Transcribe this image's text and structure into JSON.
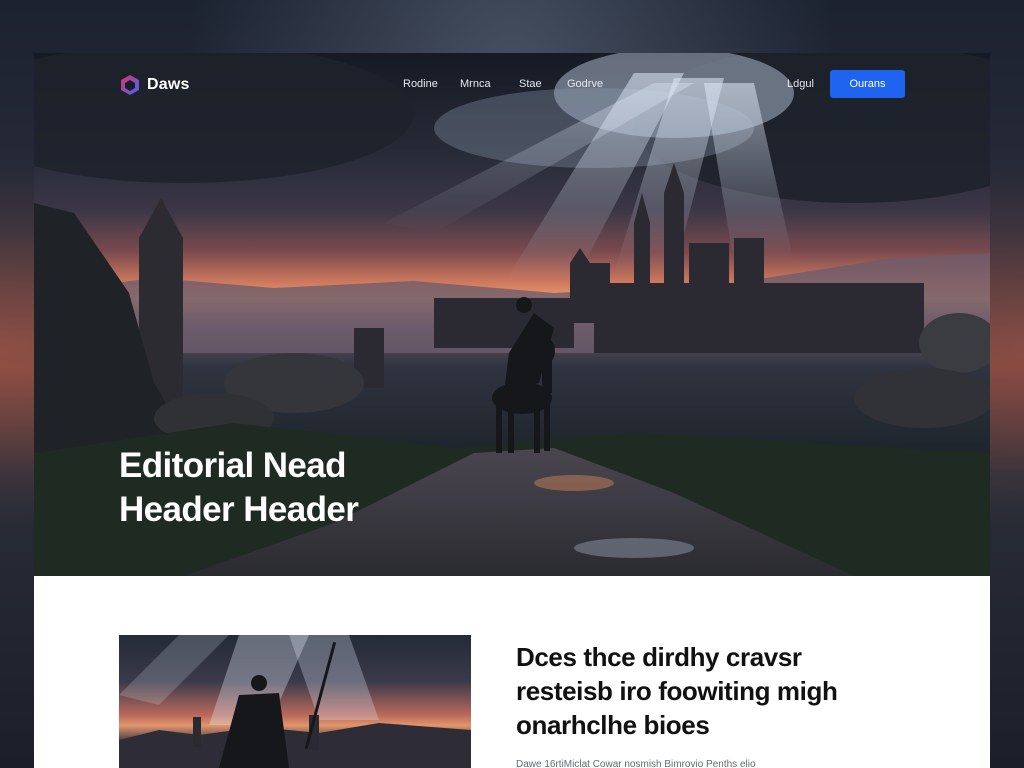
{
  "brand": {
    "name": "Daws"
  },
  "nav": {
    "links": [
      "Rodine",
      "Mrnca",
      "Stae",
      "Godrve"
    ],
    "login": "Ldgul",
    "cta": "Ourans"
  },
  "hero": {
    "title_line1": "Editorial Nead",
    "title_line2": "Header Header"
  },
  "article": {
    "title_lines": [
      "Dces thce dirdhy cravsr",
      "resteisb iro foowiting migh",
      "onarhclhe bioes"
    ],
    "meta": "Dawe 16rtiMiclat    Cowar nosmish Bimrovio Penths elio"
  },
  "colors": {
    "accent": "#1e64f0",
    "logo_gradient": [
      "#e0306a",
      "#3a6cf0"
    ]
  }
}
